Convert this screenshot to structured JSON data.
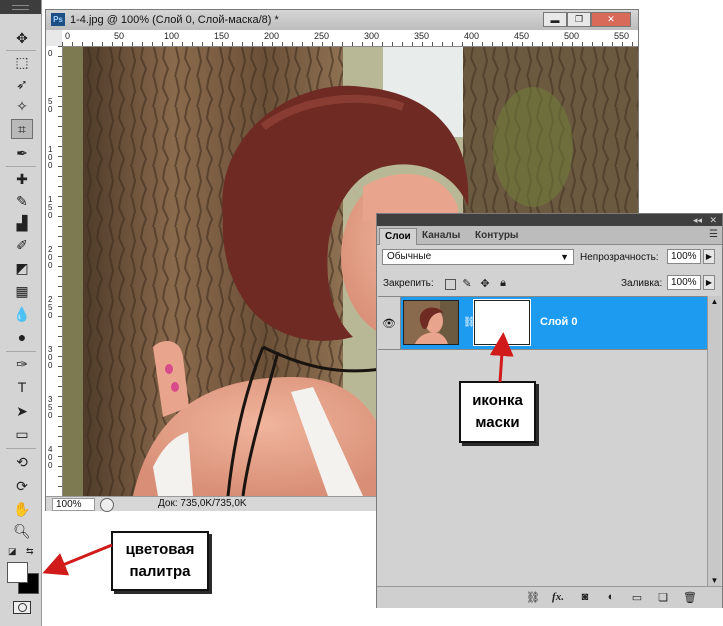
{
  "document": {
    "title": "1-4.jpg @ 100% (Слой 0, Слой-маска/8) *",
    "app_badge": "Ps",
    "zoom": "100%",
    "doc_size": "Док: 735,0K/735,0K",
    "ruler_top": [
      "0",
      "50",
      "100",
      "150",
      "200",
      "250",
      "300",
      "350",
      "400",
      "450",
      "500",
      "550"
    ],
    "ruler_left": [
      "0",
      "50",
      "100",
      "150",
      "200",
      "250",
      "300",
      "350",
      "400"
    ],
    "window_buttons": {
      "minimize": "▬",
      "restore": "❐",
      "close": "✕"
    }
  },
  "layers_panel": {
    "tabs": [
      "Слои",
      "Каналы",
      "Контуры"
    ],
    "active_tab": "Слои",
    "blend_mode": "Обычные",
    "opacity_label": "Непрозрачность:",
    "opacity_value": "100%",
    "lock_label": "Закрепить:",
    "fill_label": "Заливка:",
    "fill_value": "100%",
    "layer_name": "Слой 0",
    "bottom_icons": [
      "link-icon",
      "fx-icon",
      "mask-icon",
      "adjustment-icon",
      "folder-icon",
      "new-layer-icon",
      "trash-icon"
    ],
    "fx_label": "fx."
  },
  "callouts": {
    "mask": {
      "line1": "иконка",
      "line2": "маски"
    },
    "palette": {
      "line1": "цветовая",
      "line2": "палитра"
    }
  },
  "colors": {
    "layer_selected": "#1c9bf1",
    "arrow": "#d11a1a",
    "panel_dark": "#3f3f3f"
  },
  "tools": [
    "move-icon",
    "marquee-icon",
    "lasso-icon",
    "quick-select-icon",
    "crop-icon",
    "eyedropper-icon",
    "healing-icon",
    "brush-icon",
    "clone-stamp-icon",
    "history-brush-icon",
    "eraser-icon",
    "gradient-icon",
    "blur-icon",
    "dodge-icon",
    "pen-icon",
    "type-icon",
    "path-select-icon",
    "shape-icon",
    "3d-rotate-icon",
    "3d-orbit-icon",
    "hand-icon",
    "zoom-icon"
  ]
}
